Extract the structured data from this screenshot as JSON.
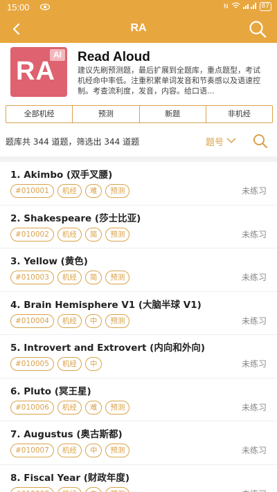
{
  "status": {
    "time": "15:00",
    "battery": "87"
  },
  "appbar": {
    "title": "RA"
  },
  "header": {
    "logo_text": "RA",
    "logo_badge": "AI",
    "name": "Read Aloud",
    "desc": "建议先刷预测题，最后扩展到全题库，重点题型，考试机经命中率低。注重积累单词发音和节奏感以及语速控制。考查流利度，发音，内容。给口语..."
  },
  "filters": [
    "全部机经",
    "预测",
    "新题",
    "非机经"
  ],
  "summary": {
    "text": "题库共 344 道题，筛选出 344 道题",
    "sort": "题号"
  },
  "colors": {
    "accent": "#e8a63f",
    "tag": "#d9a24a",
    "logo": "#de6270"
  },
  "items": [
    {
      "title": "1. Akimbo (双手叉腰)",
      "tags": [
        "#010001",
        "机经",
        "难",
        "预测"
      ],
      "status": "未练习"
    },
    {
      "title": "2. Shakespeare (莎士比亚)",
      "tags": [
        "#010002",
        "机经",
        "简",
        "预测"
      ],
      "status": "未练习"
    },
    {
      "title": "3. Yellow (黄色)",
      "tags": [
        "#010003",
        "机经",
        "简",
        "预测"
      ],
      "status": "未练习"
    },
    {
      "title": "4. Brain Hemisphere V1 (大脑半球 V1)",
      "tags": [
        "#010004",
        "机经",
        "中",
        "预测"
      ],
      "status": "未练习"
    },
    {
      "title": "5. Introvert and Extrovert (内向和外向)",
      "tags": [
        "#010005",
        "机经",
        "中"
      ],
      "status": "未练习"
    },
    {
      "title": "6. Pluto (冥王星)",
      "tags": [
        "#010006",
        "机经",
        "难",
        "预测"
      ],
      "status": "未练习"
    },
    {
      "title": "7. Augustus (奥古斯都)",
      "tags": [
        "#010007",
        "机经",
        "中",
        "预测"
      ],
      "status": "未练习"
    },
    {
      "title": "8. Fiscal Year (财政年度)",
      "tags": [
        "#010008",
        "机经",
        "中",
        "预测"
      ],
      "status": "未练习"
    }
  ]
}
